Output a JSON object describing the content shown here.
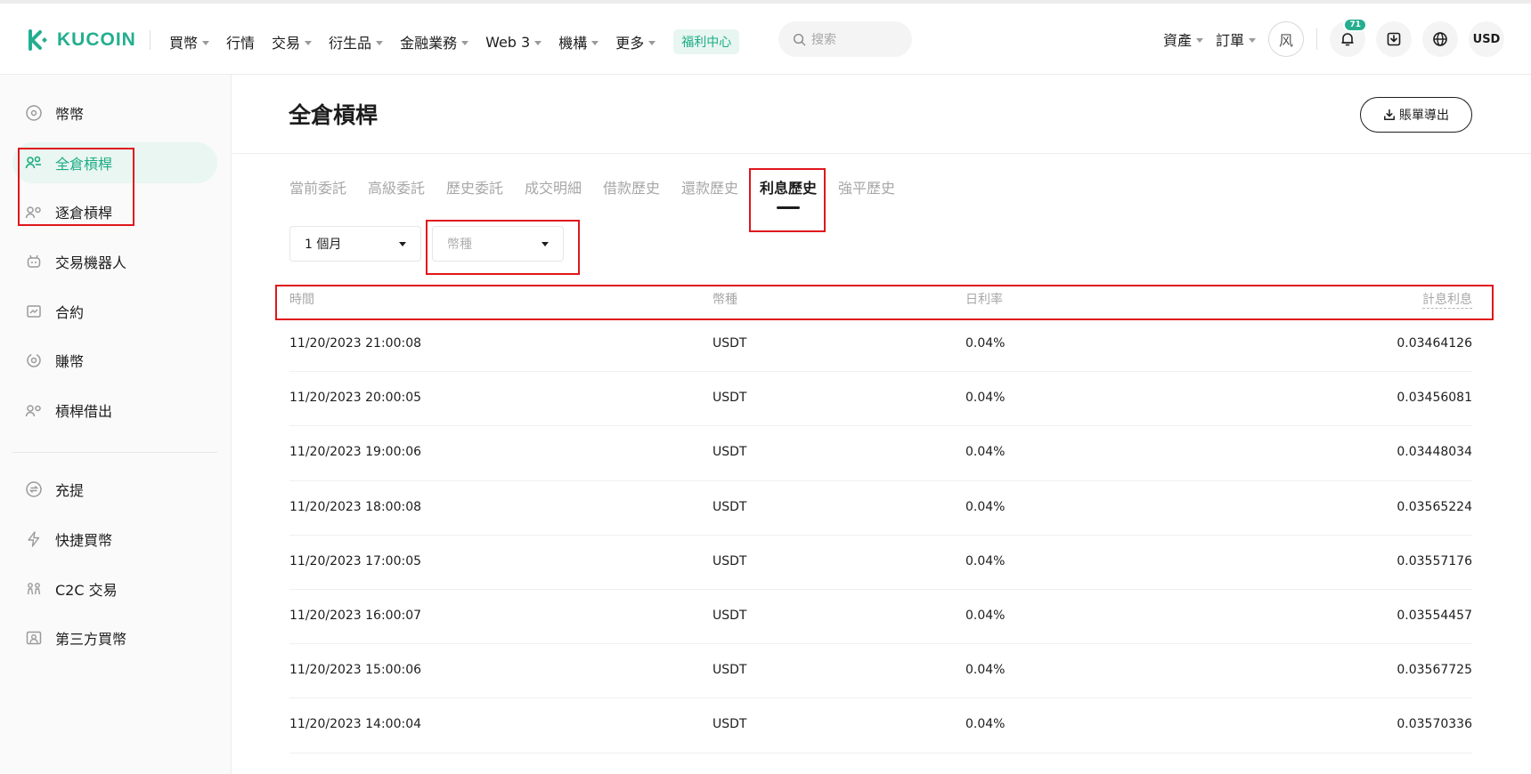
{
  "header": {
    "logo_text": "KUCOIN",
    "nav": [
      {
        "label": "買幣",
        "dropdown": true
      },
      {
        "label": "行情",
        "dropdown": false
      },
      {
        "label": "交易",
        "dropdown": true
      },
      {
        "label": "衍生品",
        "dropdown": true
      },
      {
        "label": "金融業務",
        "dropdown": true
      },
      {
        "label": "Web 3",
        "dropdown": true
      },
      {
        "label": "機構",
        "dropdown": true
      },
      {
        "label": "更多",
        "dropdown": true
      }
    ],
    "welfare_label": "福利中心",
    "search_placeholder": "搜索",
    "assets_label": "資產",
    "orders_label": "訂單",
    "avatar_text": "风",
    "notification_count": "71",
    "currency_label": "USD"
  },
  "sidebar": {
    "items": [
      {
        "label": "幣幣",
        "icon": "coin-icon",
        "active": false
      },
      {
        "label": "全倉槓桿",
        "icon": "cross-margin-icon",
        "active": true
      },
      {
        "label": "逐倉槓桿",
        "icon": "isolated-margin-icon",
        "active": false
      },
      {
        "label": "交易機器人",
        "icon": "robot-icon",
        "active": false
      },
      {
        "label": "合約",
        "icon": "futures-icon",
        "active": false
      },
      {
        "label": "賺幣",
        "icon": "earn-icon",
        "active": false
      },
      {
        "label": "槓桿借出",
        "icon": "lending-icon",
        "active": false
      },
      {
        "label": "充提",
        "icon": "deposit-withdraw-icon",
        "active": false
      },
      {
        "label": "快捷買幣",
        "icon": "lightning-icon",
        "active": false
      },
      {
        "label": "C2C 交易",
        "icon": "c2c-icon",
        "active": false
      },
      {
        "label": "第三方買幣",
        "icon": "third-party-icon",
        "active": false
      }
    ]
  },
  "main": {
    "title": "全倉槓桿",
    "export_label": "賬單導出",
    "tabs": [
      "當前委託",
      "高級委託",
      "歷史委託",
      "成交明細",
      "借款歷史",
      "還款歷史",
      "利息歷史",
      "強平歷史"
    ],
    "active_tab": "利息歷史",
    "filters": {
      "period": "1 個月",
      "currency_placeholder": "幣種"
    },
    "table": {
      "columns": [
        "時間",
        "幣種",
        "日利率",
        "計息利息"
      ],
      "rows": [
        [
          "11/20/2023 21:00:08",
          "USDT",
          "0.04%",
          "0.03464126"
        ],
        [
          "11/20/2023 20:00:05",
          "USDT",
          "0.04%",
          "0.03456081"
        ],
        [
          "11/20/2023 19:00:06",
          "USDT",
          "0.04%",
          "0.03448034"
        ],
        [
          "11/20/2023 18:00:08",
          "USDT",
          "0.04%",
          "0.03565224"
        ],
        [
          "11/20/2023 17:00:05",
          "USDT",
          "0.04%",
          "0.03557176"
        ],
        [
          "11/20/2023 16:00:07",
          "USDT",
          "0.04%",
          "0.03554457"
        ],
        [
          "11/20/2023 15:00:06",
          "USDT",
          "0.04%",
          "0.03567725"
        ],
        [
          "11/20/2023 14:00:04",
          "USDT",
          "0.04%",
          "0.03570336"
        ]
      ]
    }
  },
  "colors": {
    "brand": "#24ae8f",
    "active_text": "#1dac83",
    "active_bg": "#e9f6f1",
    "highlight": "#e0161c"
  }
}
